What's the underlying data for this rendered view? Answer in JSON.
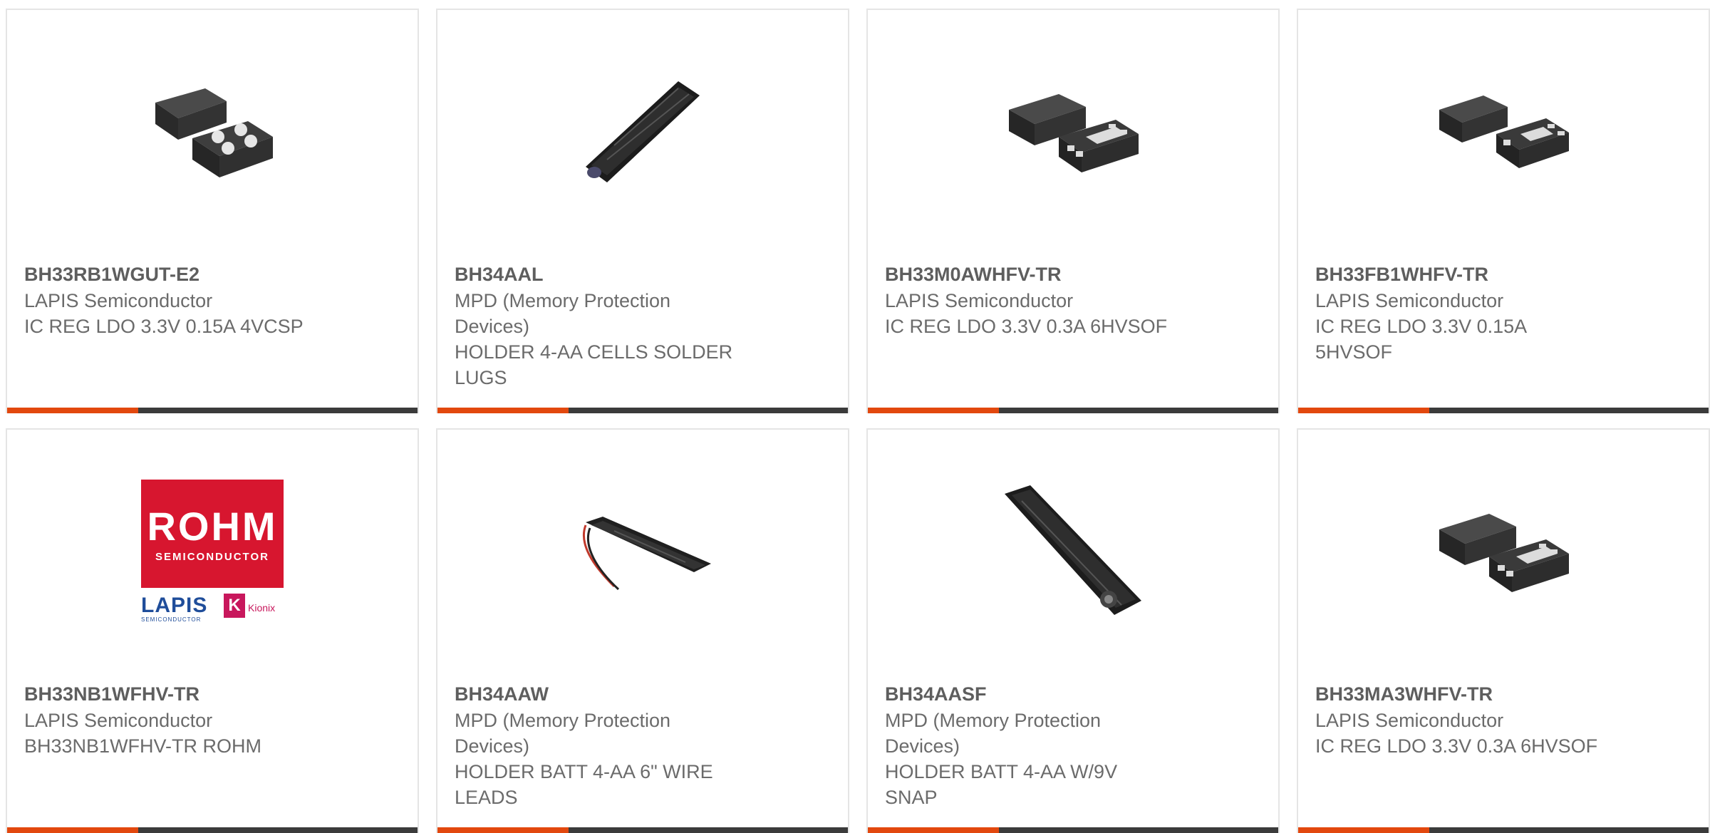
{
  "cards": [
    {
      "part": "BH33RB1WGUT-E2",
      "manufacturer": "LAPIS Semiconductor",
      "description_lines": [
        "IC REG LDO 3.3V 0.15A 4VCSP"
      ],
      "image": "chip-4vcsp-icon"
    },
    {
      "part": "BH34AAL",
      "manufacturer_lines": [
        "MPD (Memory Protection",
        "Devices)"
      ],
      "description_lines": [
        "HOLDER 4-AA CELLS SOLDER",
        "LUGS"
      ],
      "image": "battery-holder-icon"
    },
    {
      "part": "BH33M0AWHFV-TR",
      "manufacturer": "LAPIS Semiconductor",
      "description_lines": [
        "IC REG LDO 3.3V 0.3A 6HVSOF"
      ],
      "image": "chip-6hvsof-icon"
    },
    {
      "part": "BH33FB1WHFV-TR",
      "manufacturer": "LAPIS Semiconductor",
      "description_lines": [
        "IC REG LDO 3.3V 0.15A",
        "5HVSOF"
      ],
      "image": "chip-5hvsof-icon"
    },
    {
      "part": "BH33NB1WFHV-TR",
      "manufacturer": "LAPIS Semiconductor",
      "description_lines": [
        "BH33NB1WFHV-TR ROHM"
      ],
      "image": "rohm-logo",
      "logo": {
        "brand": "ROHM",
        "brand_sub": "SEMICONDUCTOR",
        "lapis": "LAPIS",
        "lapis_sub": "SEMICONDUCTOR",
        "kionix": "Kionix"
      }
    },
    {
      "part": "BH34AAW",
      "manufacturer_lines": [
        "MPD (Memory Protection",
        "Devices)"
      ],
      "description_lines": [
        "HOLDER BATT 4-AA 6\" WIRE",
        "LEADS"
      ],
      "image": "battery-holder-wire-icon"
    },
    {
      "part": "BH34AASF",
      "manufacturer_lines": [
        "MPD (Memory Protection",
        "Devices)"
      ],
      "description_lines": [
        "HOLDER BATT 4-AA W/9V",
        "SNAP"
      ],
      "image": "battery-holder-snap-icon"
    },
    {
      "part": "BH33MA3WHFV-TR",
      "manufacturer": "LAPIS Semiconductor",
      "description_lines": [
        "IC REG LDO 3.3V 0.3A 6HVSOF"
      ],
      "image": "chip-6hvsof-icon"
    }
  ],
  "colors": {
    "accent_orange": "#e2480e",
    "accent_dark": "#3b3b3b",
    "text": "#6b6b6b",
    "border": "#e5e5e5"
  }
}
